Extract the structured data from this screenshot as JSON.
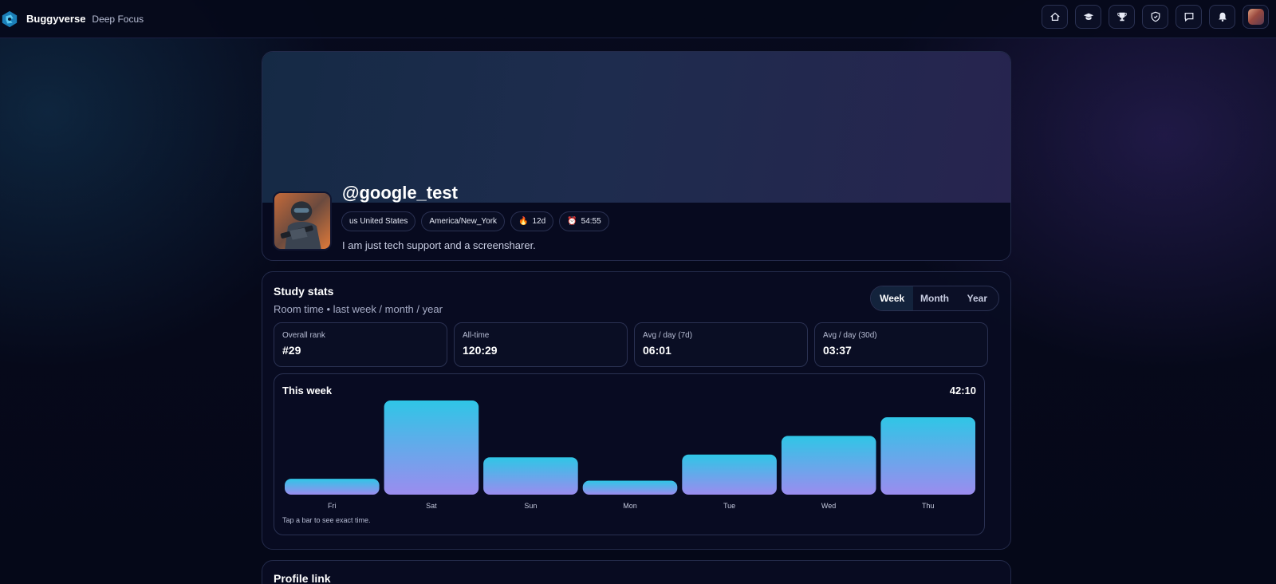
{
  "header": {
    "brand_name": "Buggyverse",
    "brand_sub": "Deep Focus",
    "nav_icons": [
      "home-icon",
      "graduation-cap-icon",
      "trophy-icon",
      "shield-icon",
      "chat-icon",
      "bell-icon"
    ]
  },
  "profile": {
    "username": "@google_test",
    "chips": {
      "country": "us United States",
      "timezone": "America/New_York",
      "streak": "12d",
      "time": "54:55"
    },
    "bio": "I am just tech support and a screensharer."
  },
  "stats": {
    "title": "Study stats",
    "subtitle": "Room time • last week / month / year",
    "range_tabs": [
      "Week",
      "Month",
      "Year"
    ],
    "active_tab": "Week",
    "tiles": [
      {
        "label": "Overall rank",
        "value": "#29"
      },
      {
        "label": "All-time",
        "value": "120:29"
      },
      {
        "label": "Avg / day (7d)",
        "value": "06:01"
      },
      {
        "label": "Avg / day (30d)",
        "value": "03:37"
      }
    ]
  },
  "chart_data": {
    "type": "bar",
    "title": "This week",
    "total": "42:10",
    "categories": [
      "Fri",
      "Sat",
      "Sun",
      "Mon",
      "Tue",
      "Wed",
      "Thu"
    ],
    "values": [
      1.7,
      10.1,
      4.0,
      1.5,
      4.3,
      6.3,
      8.3
    ],
    "ylim": [
      0,
      10.1
    ],
    "colors": {
      "top": "#2fc6e6",
      "bottom": "#9b8cef"
    },
    "hint": "Tap a bar to see exact time."
  },
  "profile_link": {
    "title": "Profile link"
  },
  "colors": {
    "background": "#050818",
    "card_border": "#232a4a",
    "accent": "#2fc6e6"
  }
}
